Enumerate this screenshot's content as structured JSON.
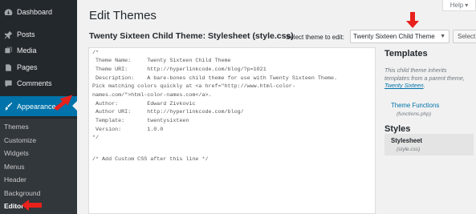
{
  "sidebar": {
    "items": [
      {
        "label": "Dashboard",
        "icon": "dashboard-icon"
      },
      {
        "label": "Posts",
        "icon": "pin-icon"
      },
      {
        "label": "Media",
        "icon": "media-icon"
      },
      {
        "label": "Pages",
        "icon": "pages-icon"
      },
      {
        "label": "Comments",
        "icon": "comment-icon"
      },
      {
        "label": "Appearance",
        "icon": "brush-icon"
      }
    ],
    "submenu": [
      "Themes",
      "Customize",
      "Widgets",
      "Menus",
      "Header",
      "Background",
      "Editor"
    ]
  },
  "header": {
    "help_label": "Help",
    "page_title": "Edit Themes",
    "file_title": "Twenty Sixteen Child Theme: Stylesheet (style.css)",
    "select_label": "Select theme to edit:",
    "selected_theme": "Twenty Sixteen Child Theme",
    "select_button": "Select"
  },
  "editor": {
    "lines": [
      "/*",
      " Theme Name:     Twenty Sixteen Child Theme",
      " Theme URI:      http://hyperlinkcode.com/blog/?p=1021",
      " Description:    A bare-bones child theme for use with Twenty Sixteen Theme.",
      "Pick matching colors quickly at <a href=\"http://www.html-color-",
      "names.com/\">html-color-names.com</a>.",
      " Author:         Edward Zivkovic",
      " Author URI:     http://hyperlinkcode.com/blog/",
      " Template:       twentysixteen",
      " Version:        1.0.0",
      "*/",
      "",
      "/* Add Custom CSS after this line */"
    ]
  },
  "templates": {
    "heading": "Templates",
    "desc_prefix": "This child theme inherits templates from a parent theme,",
    "desc_link": "Twenty Sixteen",
    "desc_suffix": ".",
    "items": [
      {
        "label": "Theme Functions",
        "file": "(functions.php)"
      }
    ]
  },
  "styles": {
    "heading": "Styles",
    "items": [
      {
        "label": "Stylesheet",
        "file": "(style.css)"
      }
    ]
  },
  "colors": {
    "sidebar_bg": "#23282d",
    "submenu_bg": "#32373c",
    "active_bg": "#0073aa",
    "annotation": "#e8211c",
    "link": "#0073aa"
  }
}
